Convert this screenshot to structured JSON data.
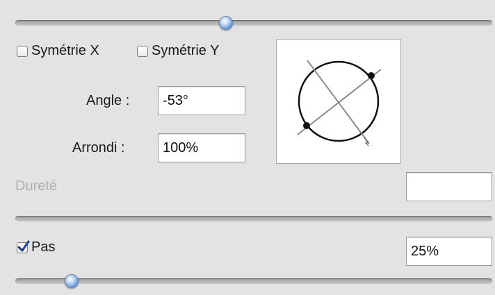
{
  "brush_panel": {
    "sym_x_label": "Symétrie X",
    "sym_y_label": "Symétrie Y",
    "sym_x_checked": false,
    "sym_y_checked": false,
    "angle_label": "Angle :",
    "angle_value": "-53°",
    "roundness_label": "Arrondi :",
    "roundness_value": "100%",
    "hardness_label": "Dureté",
    "hardness_value": "",
    "spacing_label": "Pas",
    "spacing_checked": true,
    "spacing_value": "25%"
  },
  "colors": {
    "background": "#e3e3e3",
    "knob_accent": "#5b93d8"
  },
  "icons": {
    "checkbox_checked": "check-mark",
    "preview": "brush-tip-ellipse"
  }
}
